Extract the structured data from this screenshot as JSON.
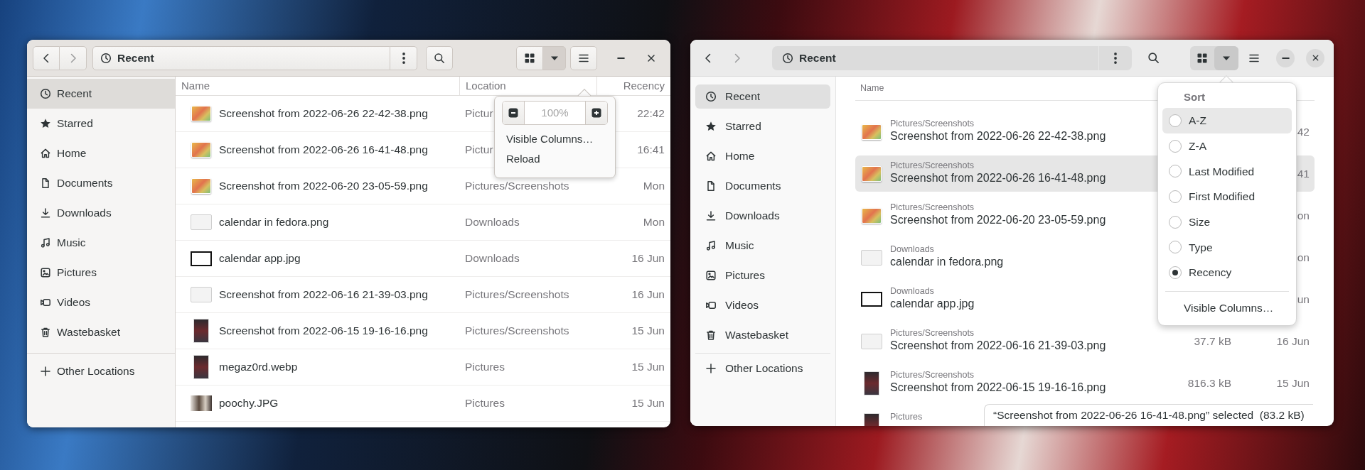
{
  "left_window": {
    "path_bar": {
      "label": "Recent"
    },
    "sidebar": {
      "items": [
        {
          "label": "Recent",
          "selected": true
        },
        {
          "label": "Starred",
          "selected": false
        },
        {
          "label": "Home",
          "selected": false
        },
        {
          "label": "Documents",
          "selected": false
        },
        {
          "label": "Downloads",
          "selected": false
        },
        {
          "label": "Music",
          "selected": false
        },
        {
          "label": "Pictures",
          "selected": false
        },
        {
          "label": "Videos",
          "selected": false
        },
        {
          "label": "Wastebasket",
          "selected": false
        }
      ],
      "other_locations": "Other Locations"
    },
    "columns": [
      "Name",
      "Location",
      "Recency"
    ],
    "rows": [
      {
        "kind": "gradient",
        "name": "Screenshot from 2022-06-26 22-42-38.png",
        "location": "Pictur",
        "recency": "22:42"
      },
      {
        "kind": "gradient",
        "name": "Screenshot from 2022-06-26 16-41-48.png",
        "location": "Pictur",
        "recency": "16:41"
      },
      {
        "kind": "gradient",
        "name": "Screenshot from 2022-06-20 23-05-59.png",
        "location": "Pictures/Screenshots",
        "recency": "Mon"
      },
      {
        "kind": "blank",
        "name": "calendar in fedora.png",
        "location": "Downloads",
        "recency": "Mon"
      },
      {
        "kind": "framed",
        "name": "calendar app.jpg",
        "location": "Downloads",
        "recency": "16 Jun"
      },
      {
        "kind": "blank",
        "name": "Screenshot from 2022-06-16 21-39-03.png",
        "location": "Pictures/Screenshots",
        "recency": "16 Jun"
      },
      {
        "kind": "portrait",
        "name": "Screenshot from 2022-06-15 19-16-16.png",
        "location": "Pictures/Screenshots",
        "recency": "15 Jun"
      },
      {
        "kind": "portrait",
        "name": "megaz0rd.webp",
        "location": "Pictures",
        "recency": "15 Jun"
      },
      {
        "kind": "photo",
        "name": "poochy.JPG",
        "location": "Pictures",
        "recency": "15 Jun"
      }
    ],
    "view_menu": {
      "zoom_level": "100%",
      "items": [
        "Visible Columns…",
        "Reload"
      ]
    }
  },
  "right_window": {
    "path_bar": {
      "label": "Recent"
    },
    "sidebar": {
      "items": [
        {
          "label": "Recent",
          "selected": true
        },
        {
          "label": "Starred",
          "selected": false
        },
        {
          "label": "Home",
          "selected": false
        },
        {
          "label": "Documents",
          "selected": false
        },
        {
          "label": "Downloads",
          "selected": false
        },
        {
          "label": "Music",
          "selected": false
        },
        {
          "label": "Pictures",
          "selected": false
        },
        {
          "label": "Videos",
          "selected": false
        },
        {
          "label": "Wastebasket",
          "selected": false
        }
      ],
      "other_locations": "Other Locations"
    },
    "columns": [
      "Name"
    ],
    "rows": [
      {
        "kind": "gradient",
        "location": "Pictures/Screenshots",
        "name": "Screenshot from 2022-06-26 22-42-38.png",
        "recency": "42",
        "selected": false
      },
      {
        "kind": "gradient",
        "location": "Pictures/Screenshots",
        "name": "Screenshot from 2022-06-26 16-41-48.png",
        "recency": "41",
        "selected": true
      },
      {
        "kind": "gradient",
        "location": "Pictures/Screenshots",
        "name": "Screenshot from 2022-06-20 23-05-59.png",
        "recency": "on",
        "selected": false
      },
      {
        "kind": "blank",
        "location": "Downloads",
        "name": "calendar in fedora.png",
        "recency": "on",
        "selected": false
      },
      {
        "kind": "framed",
        "location": "Downloads",
        "name": "calendar app.jpg",
        "recency": "un",
        "selected": false
      },
      {
        "kind": "blank",
        "location": "Pictures/Screenshots",
        "name": "Screenshot from 2022-06-16 21-39-03.png",
        "size": "37.7 kB",
        "recency": "16 Jun",
        "selected": false
      },
      {
        "kind": "portrait",
        "location": "Pictures/Screenshots",
        "name": "Screenshot from 2022-06-15 19-16-16.png",
        "size": "816.3 kB",
        "recency": "15 Jun",
        "selected": false
      },
      {
        "kind": "portrait",
        "location": "Pictures",
        "selected": false
      }
    ],
    "sort_menu": {
      "title": "Sort",
      "options": [
        {
          "label": "A-Z",
          "selected": false,
          "highlighted": true
        },
        {
          "label": "Z-A",
          "selected": false,
          "highlighted": false
        },
        {
          "label": "Last Modified",
          "selected": false,
          "highlighted": false
        },
        {
          "label": "First Modified",
          "selected": false,
          "highlighted": false
        },
        {
          "label": "Size",
          "selected": false,
          "highlighted": false
        },
        {
          "label": "Type",
          "selected": false,
          "highlighted": false
        },
        {
          "label": "Recency",
          "selected": true,
          "highlighted": false
        }
      ],
      "footer": "Visible Columns…"
    },
    "status": "“Screenshot from 2022-06-26 16-41-48.png” selected  (83.2 kB)"
  }
}
